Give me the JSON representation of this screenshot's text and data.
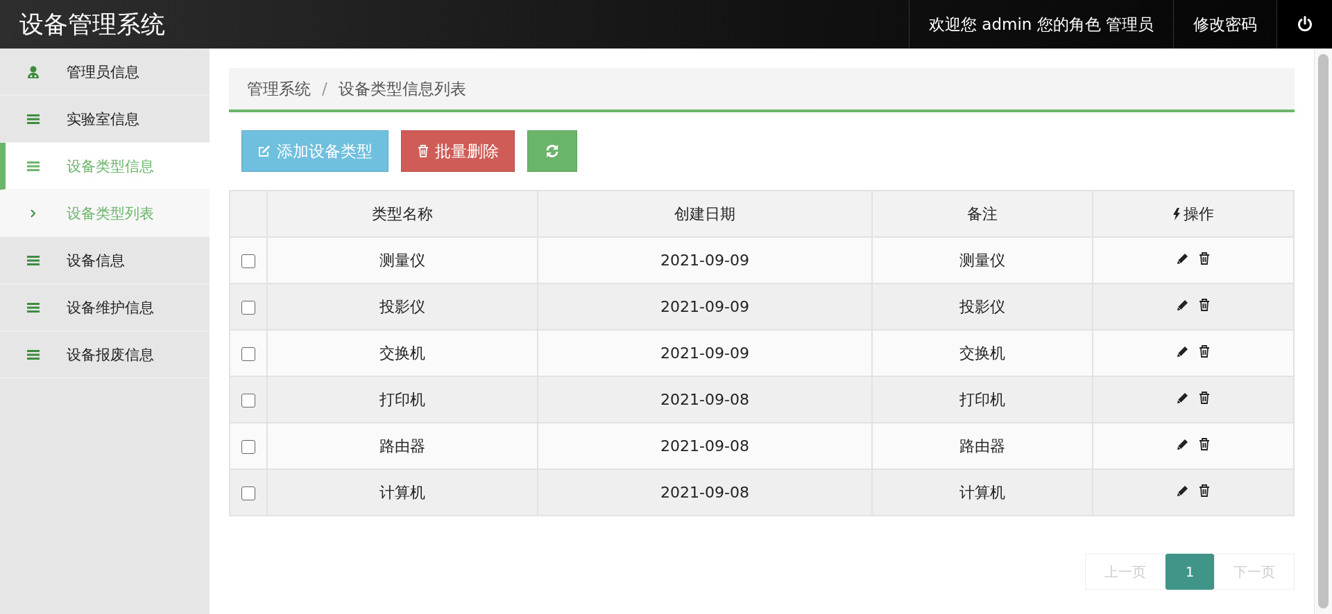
{
  "header": {
    "title": "设备管理系统",
    "welcome": "欢迎您 admin 您的角色 管理员",
    "change_password": "修改密码"
  },
  "sidebar": {
    "items": [
      {
        "label": "管理员信息",
        "kind": "user",
        "selected": false
      },
      {
        "label": "实验室信息",
        "kind": "list",
        "selected": false
      },
      {
        "label": "设备类型信息",
        "kind": "list",
        "selected": true,
        "children": [
          {
            "label": "设备类型列表",
            "selected": true
          }
        ]
      },
      {
        "label": "设备信息",
        "kind": "list",
        "selected": false
      },
      {
        "label": "设备维护信息",
        "kind": "list",
        "selected": false
      },
      {
        "label": "设备报废信息",
        "kind": "list",
        "selected": false
      }
    ]
  },
  "breadcrumb": {
    "separator": "/",
    "items": [
      "管理系统",
      "设备类型信息列表"
    ]
  },
  "toolbar": {
    "add": "添加设备类型",
    "batch_delete": "批量删除"
  },
  "table": {
    "columns": [
      "类型名称",
      "创建日期",
      "备注",
      "操作"
    ],
    "rows": [
      {
        "checked": false,
        "cells": [
          "测量仪",
          "2021-09-09",
          "测量仪"
        ]
      },
      {
        "checked": false,
        "cells": [
          "投影仪",
          "2021-09-09",
          "投影仪"
        ]
      },
      {
        "checked": false,
        "cells": [
          "交换机",
          "2021-09-09",
          "交换机"
        ]
      },
      {
        "checked": false,
        "cells": [
          "打印机",
          "2021-09-08",
          "打印机"
        ]
      },
      {
        "checked": false,
        "cells": [
          "路由器",
          "2021-09-08",
          "路由器"
        ]
      },
      {
        "checked": false,
        "cells": [
          "计算机",
          "2021-09-08",
          "计算机"
        ]
      }
    ]
  },
  "pagination": {
    "prev": {
      "label": "上一页",
      "disabled": true
    },
    "pages": [
      {
        "label": "1",
        "selected": true
      }
    ],
    "next": {
      "label": "下一页",
      "disabled": true
    }
  }
}
